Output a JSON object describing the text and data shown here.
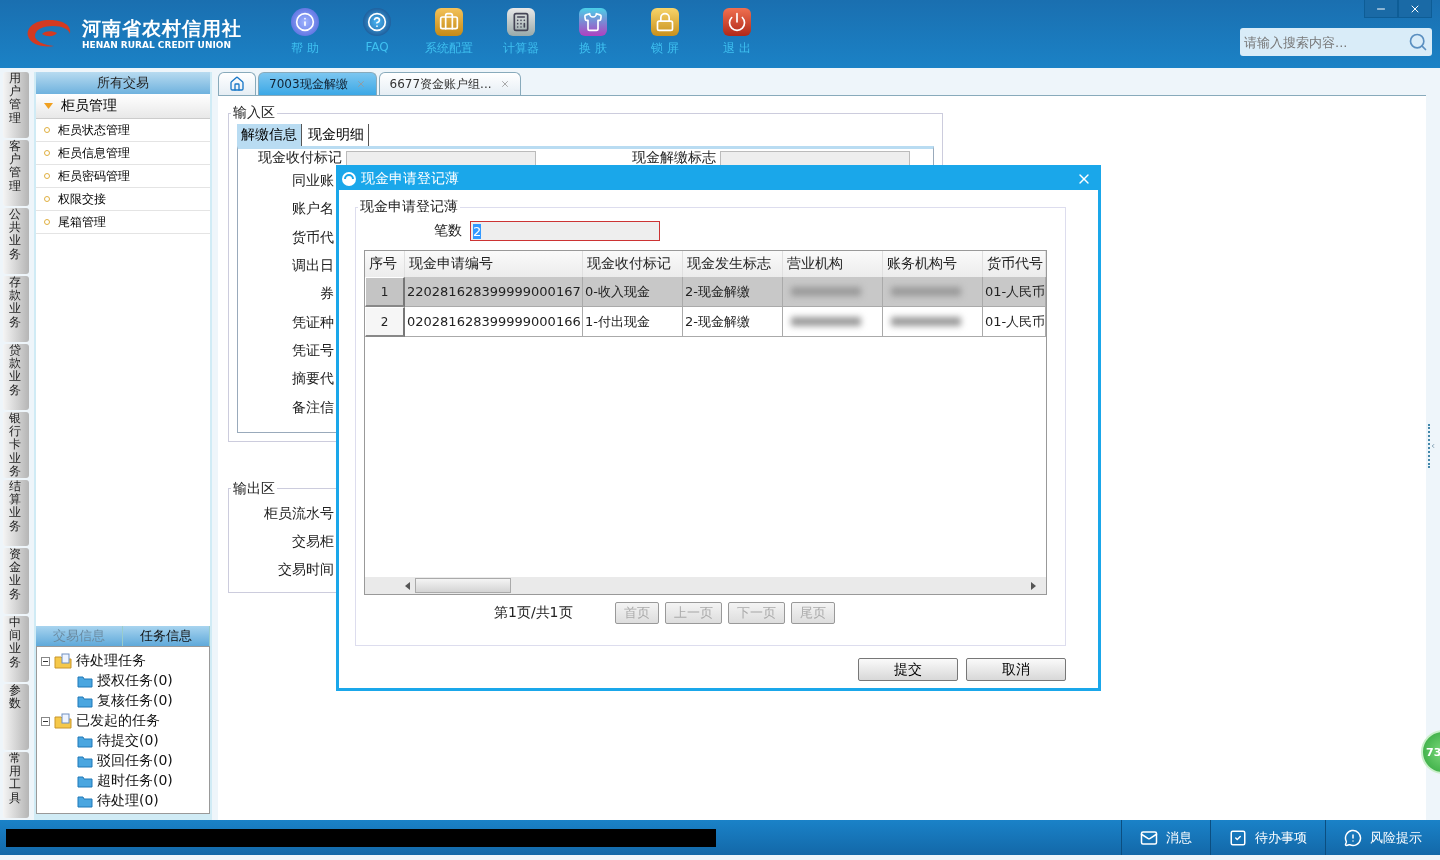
{
  "header": {
    "logo_cn": "河南省农村信用社",
    "logo_en": "HENAN RURAL CREDIT UNION",
    "toolbar": [
      {
        "kind": "help",
        "label": "帮 助"
      },
      {
        "kind": "faq",
        "label": "FAQ"
      },
      {
        "kind": "config",
        "label": "系统配置"
      },
      {
        "kind": "calculator",
        "label": "计算器"
      },
      {
        "kind": "skin",
        "label": "换 肤"
      },
      {
        "kind": "lock",
        "label": "锁 屏"
      },
      {
        "kind": "exit",
        "label": "退 出"
      }
    ],
    "search": {
      "placeholder": "请输入搜索内容..."
    }
  },
  "side_tabs": [
    "用户管理",
    "客户管理",
    "公共业务",
    "存款业务",
    "贷款业务",
    "银行卡业务",
    "结算业务",
    "资金业务",
    "中间业务",
    "参数",
    "常用工具"
  ],
  "nav": {
    "title": "所有交易",
    "groups": [
      {
        "label": "柜员管理",
        "expanded": true,
        "items": [
          "柜员状态管理",
          "柜员信息管理",
          "柜员密码管理",
          "权限交接",
          "尾箱管理"
        ]
      }
    ]
  },
  "task_panel": {
    "tabs": [
      {
        "label": "交易信息",
        "selected": false
      },
      {
        "label": "任务信息",
        "selected": true
      }
    ],
    "tree": [
      {
        "label": "待处理任务",
        "expanded": true,
        "children": [
          {
            "label": "授权任务(0)"
          },
          {
            "label": "复核任务(0)"
          }
        ]
      },
      {
        "label": "已发起的任务",
        "expanded": true,
        "children": [
          {
            "label": "待提交(0)"
          },
          {
            "label": "驳回任务(0)"
          },
          {
            "label": "超时任务(0)"
          },
          {
            "label": "待处理(0)"
          }
        ]
      }
    ]
  },
  "tabs": [
    {
      "kind": "home",
      "selected": false
    },
    {
      "kind": "page",
      "label": "7003现金解缴",
      "selected": true
    },
    {
      "kind": "page",
      "label": "6677资金账户组...",
      "selected": false
    }
  ],
  "input_area": {
    "legend": "输入区",
    "tabs": [
      {
        "label": "解缴信息",
        "selected": true
      },
      {
        "label": "现金明细",
        "selected": false
      }
    ],
    "top_labels": [
      "现金收付标记",
      "现金解缴标志"
    ],
    "fields": [
      "同业账",
      "账户名",
      "货币代",
      "调出日",
      "券",
      "凭证种",
      "凭证号",
      "摘要代",
      "备注信"
    ]
  },
  "output_area": {
    "legend": "输出区",
    "fields": [
      "柜员流水号",
      "交易柜",
      "交易时间"
    ]
  },
  "dialog": {
    "title": "现金申请登记薄",
    "legend": "现金申请登记薄",
    "count_label": "笔数",
    "count_value": "2",
    "columns": [
      "序号",
      "现金申请编号",
      "现金收付标记",
      "现金发生标志",
      "营业机构",
      "账务机构号",
      "货币代号"
    ],
    "rows": [
      {
        "selected": true,
        "cells": [
          {
            "kind": "index",
            "text": "1"
          },
          {
            "kind": "text",
            "text": "220281628399999000167"
          },
          {
            "kind": "text",
            "text": "0-收入现金"
          },
          {
            "kind": "text",
            "text": "2-现金解缴"
          },
          {
            "kind": "blurred"
          },
          {
            "kind": "blurred"
          },
          {
            "kind": "text",
            "text": "01-人民币"
          }
        ]
      },
      {
        "selected": false,
        "cells": [
          {
            "kind": "index",
            "text": "2"
          },
          {
            "kind": "text",
            "text": "020281628399999000166"
          },
          {
            "kind": "text",
            "text": "1-付出现金"
          },
          {
            "kind": "text",
            "text": "2-现金解缴"
          },
          {
            "kind": "blurred"
          },
          {
            "kind": "blurred"
          },
          {
            "kind": "text",
            "text": "01-人民币"
          }
        ]
      }
    ],
    "page_info": "第1页/共1页",
    "pager": [
      {
        "label": "首页",
        "disabled": true
      },
      {
        "label": "上一页",
        "disabled": true
      },
      {
        "label": "下一页",
        "disabled": true
      },
      {
        "label": "尾页",
        "disabled": true
      }
    ],
    "buttons": [
      "提交",
      "取消"
    ]
  },
  "status_bar": {
    "items": [
      {
        "kind": "message",
        "label": "消息"
      },
      {
        "kind": "todo",
        "label": "待办事项"
      },
      {
        "kind": "risk",
        "label": "风险提示"
      }
    ]
  },
  "badge": "73"
}
